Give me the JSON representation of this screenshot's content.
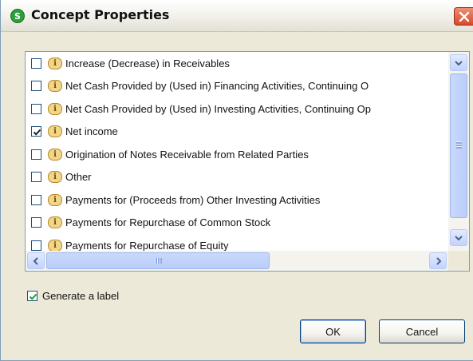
{
  "window": {
    "title": "Concept Properties"
  },
  "list": {
    "items": [
      {
        "label": "Increase (Decrease) in Receivables",
        "checked": false
      },
      {
        "label": "Net Cash Provided by (Used in) Financing Activities, Continuing O",
        "checked": false
      },
      {
        "label": "Net Cash Provided by (Used in) Investing Activities, Continuing Op",
        "checked": false
      },
      {
        "label": "Net income",
        "checked": true
      },
      {
        "label": "Origination of Notes Receivable from Related Parties",
        "checked": false
      },
      {
        "label": "Other",
        "checked": false
      },
      {
        "label": "Payments for (Proceeds from) Other Investing Activities",
        "checked": false
      },
      {
        "label": "Payments for Repurchase of Common Stock",
        "checked": false
      },
      {
        "label": "Payments for Repurchase of Equity",
        "checked": false
      }
    ],
    "item_icon": "info-icon"
  },
  "options": {
    "generate_label": "Generate a label",
    "generate_label_checked": true
  },
  "buttons": {
    "ok": "OK",
    "cancel": "Cancel"
  },
  "colors": {
    "dialog_background": "#ece9d8",
    "close_button": "#d9472b",
    "app_icon": "#2e9e3a",
    "info_icon": "#f3d58a"
  }
}
